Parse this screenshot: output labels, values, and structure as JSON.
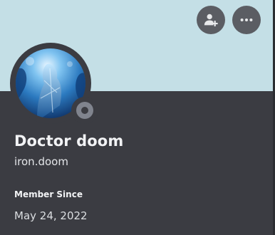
{
  "profile": {
    "display_name": "Doctor doom",
    "username": "iron.doom",
    "status": "offline",
    "banner_color": "#c4dfe6",
    "avatar": "blue-ice-figure-image"
  },
  "actions": {
    "add_friend_icon": "add-friend-icon",
    "more_icon": "more-options-icon"
  },
  "member_since": {
    "heading": "Member Since",
    "date": "May 24, 2022"
  }
}
